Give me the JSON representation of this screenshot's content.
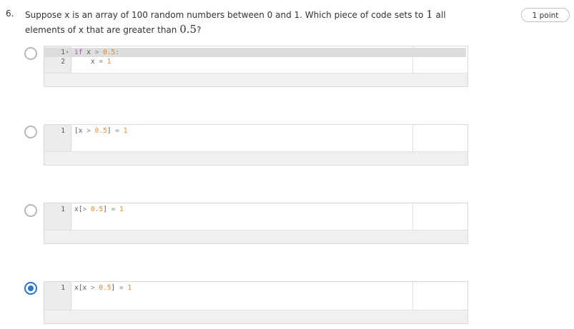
{
  "question": {
    "number": "6.",
    "text_before": "Suppose x is an array of 100 random numbers between 0 and 1. Which piece of code sets to ",
    "math_one": "1",
    "text_middle": " all elements of x that are greater than ",
    "math_half": "0.5",
    "text_end": "?",
    "points": "1 point"
  },
  "options": [
    {
      "selected": false,
      "lines": [
        {
          "n": "1",
          "fold": "▾",
          "tokens": [
            {
              "t": "if",
              "c": "kw"
            },
            {
              "t": " x ",
              "c": ""
            },
            {
              "t": ">",
              "c": "op"
            },
            {
              "t": " ",
              "c": ""
            },
            {
              "t": "0.5",
              "c": "num"
            },
            {
              "t": ":",
              "c": "op"
            }
          ]
        },
        {
          "n": "2",
          "fold": "",
          "tokens": [
            {
              "t": "    x ",
              "c": ""
            },
            {
              "t": "=",
              "c": "op"
            },
            {
              "t": " ",
              "c": ""
            },
            {
              "t": "1",
              "c": "num"
            }
          ]
        }
      ]
    },
    {
      "selected": false,
      "lines": [
        {
          "n": "1",
          "fold": "",
          "tokens": [
            {
              "t": "[x ",
              "c": ""
            },
            {
              "t": ">",
              "c": "op"
            },
            {
              "t": " ",
              "c": ""
            },
            {
              "t": "0.5",
              "c": "num"
            },
            {
              "t": "] ",
              "c": ""
            },
            {
              "t": "=",
              "c": "op"
            },
            {
              "t": " ",
              "c": ""
            },
            {
              "t": "1",
              "c": "num"
            }
          ]
        }
      ]
    },
    {
      "selected": false,
      "lines": [
        {
          "n": "1",
          "fold": "",
          "tokens": [
            {
              "t": "x[",
              "c": ""
            },
            {
              "t": ">",
              "c": "op"
            },
            {
              "t": " ",
              "c": ""
            },
            {
              "t": "0.5",
              "c": "num"
            },
            {
              "t": "] ",
              "c": ""
            },
            {
              "t": "=",
              "c": "op"
            },
            {
              "t": " ",
              "c": ""
            },
            {
              "t": "1",
              "c": "num"
            }
          ]
        }
      ]
    },
    {
      "selected": true,
      "lines": [
        {
          "n": "1",
          "fold": "",
          "tokens": [
            {
              "t": "x[x ",
              "c": ""
            },
            {
              "t": ">",
              "c": "op"
            },
            {
              "t": " ",
              "c": ""
            },
            {
              "t": "0.5",
              "c": "num"
            },
            {
              "t": "] ",
              "c": ""
            },
            {
              "t": "=",
              "c": "op"
            },
            {
              "t": " ",
              "c": ""
            },
            {
              "t": "1",
              "c": "num"
            }
          ]
        }
      ]
    }
  ],
  "colors": {
    "selected_radio": "#2a73cc",
    "keyword": "#9b4fb0",
    "number": "#e0872f"
  }
}
